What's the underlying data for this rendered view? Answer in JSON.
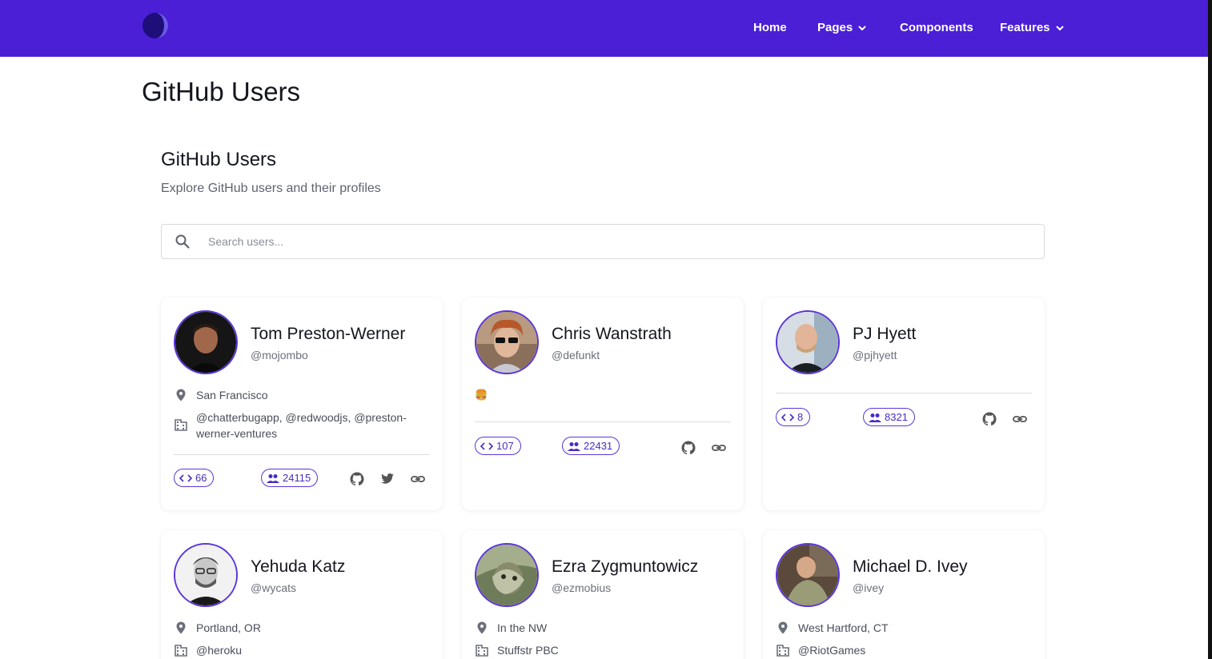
{
  "nav": {
    "items": [
      {
        "label": "Home"
      },
      {
        "label": "Pages"
      },
      {
        "label": "Components"
      },
      {
        "label": "Features"
      }
    ]
  },
  "page": {
    "title": "GitHub Users",
    "section_title": "GitHub Users",
    "section_subtitle": "Explore GitHub users and their profiles"
  },
  "search": {
    "placeholder": "Search users...",
    "value": ""
  },
  "users": [
    {
      "name": "Tom Preston-Werner",
      "login": "@mojombo",
      "location": "San Francisco",
      "company": "@chatterbugapp, @redwoodjs, @preston-werner-ventures",
      "repos": "66",
      "followers": "24115",
      "links": [
        "github-icon",
        "twitter-icon",
        "link-icon"
      ]
    },
    {
      "name": "Chris Wanstrath",
      "login": "@defunkt",
      "bio": "🍔",
      "repos": "107",
      "followers": "22431",
      "links": [
        "github-icon",
        "link-icon"
      ]
    },
    {
      "name": "PJ Hyett",
      "login": "@pjhyett",
      "repos": "8",
      "followers": "8321",
      "links": [
        "github-icon",
        "link-icon"
      ]
    },
    {
      "name": "Yehuda Katz",
      "login": "@wycats",
      "location": "Portland, OR",
      "company": "@heroku"
    },
    {
      "name": "Ezra Zygmuntowicz",
      "login": "@ezmobius",
      "location": "In the NW",
      "company": "Stuffstr PBC"
    },
    {
      "name": "Michael D. Ivey",
      "login": "@ivey",
      "location": "West Hartford, CT",
      "company": "@RiotGames"
    }
  ],
  "colors": {
    "brand": "#4a1fd6",
    "accent": "#5a35d8",
    "text": "#14161f",
    "muted": "#6b6f7b"
  }
}
